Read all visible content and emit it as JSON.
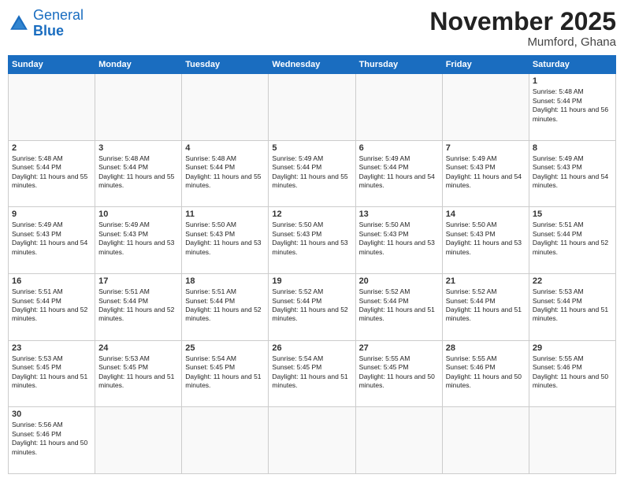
{
  "header": {
    "logo_general": "General",
    "logo_blue": "Blue",
    "month_title": "November 2025",
    "location": "Mumford, Ghana"
  },
  "weekdays": [
    "Sunday",
    "Monday",
    "Tuesday",
    "Wednesday",
    "Thursday",
    "Friday",
    "Saturday"
  ],
  "weeks": [
    [
      {
        "day": "",
        "sunrise": "",
        "sunset": "",
        "daylight": ""
      },
      {
        "day": "",
        "sunrise": "",
        "sunset": "",
        "daylight": ""
      },
      {
        "day": "",
        "sunrise": "",
        "sunset": "",
        "daylight": ""
      },
      {
        "day": "",
        "sunrise": "",
        "sunset": "",
        "daylight": ""
      },
      {
        "day": "",
        "sunrise": "",
        "sunset": "",
        "daylight": ""
      },
      {
        "day": "",
        "sunrise": "",
        "sunset": "",
        "daylight": ""
      },
      {
        "day": "1",
        "sunrise": "Sunrise: 5:48 AM",
        "sunset": "Sunset: 5:44 PM",
        "daylight": "Daylight: 11 hours and 56 minutes."
      }
    ],
    [
      {
        "day": "2",
        "sunrise": "Sunrise: 5:48 AM",
        "sunset": "Sunset: 5:44 PM",
        "daylight": "Daylight: 11 hours and 55 minutes."
      },
      {
        "day": "3",
        "sunrise": "Sunrise: 5:48 AM",
        "sunset": "Sunset: 5:44 PM",
        "daylight": "Daylight: 11 hours and 55 minutes."
      },
      {
        "day": "4",
        "sunrise": "Sunrise: 5:48 AM",
        "sunset": "Sunset: 5:44 PM",
        "daylight": "Daylight: 11 hours and 55 minutes."
      },
      {
        "day": "5",
        "sunrise": "Sunrise: 5:49 AM",
        "sunset": "Sunset: 5:44 PM",
        "daylight": "Daylight: 11 hours and 55 minutes."
      },
      {
        "day": "6",
        "sunrise": "Sunrise: 5:49 AM",
        "sunset": "Sunset: 5:44 PM",
        "daylight": "Daylight: 11 hours and 54 minutes."
      },
      {
        "day": "7",
        "sunrise": "Sunrise: 5:49 AM",
        "sunset": "Sunset: 5:43 PM",
        "daylight": "Daylight: 11 hours and 54 minutes."
      },
      {
        "day": "8",
        "sunrise": "Sunrise: 5:49 AM",
        "sunset": "Sunset: 5:43 PM",
        "daylight": "Daylight: 11 hours and 54 minutes."
      }
    ],
    [
      {
        "day": "9",
        "sunrise": "Sunrise: 5:49 AM",
        "sunset": "Sunset: 5:43 PM",
        "daylight": "Daylight: 11 hours and 54 minutes."
      },
      {
        "day": "10",
        "sunrise": "Sunrise: 5:49 AM",
        "sunset": "Sunset: 5:43 PM",
        "daylight": "Daylight: 11 hours and 53 minutes."
      },
      {
        "day": "11",
        "sunrise": "Sunrise: 5:50 AM",
        "sunset": "Sunset: 5:43 PM",
        "daylight": "Daylight: 11 hours and 53 minutes."
      },
      {
        "day": "12",
        "sunrise": "Sunrise: 5:50 AM",
        "sunset": "Sunset: 5:43 PM",
        "daylight": "Daylight: 11 hours and 53 minutes."
      },
      {
        "day": "13",
        "sunrise": "Sunrise: 5:50 AM",
        "sunset": "Sunset: 5:43 PM",
        "daylight": "Daylight: 11 hours and 53 minutes."
      },
      {
        "day": "14",
        "sunrise": "Sunrise: 5:50 AM",
        "sunset": "Sunset: 5:43 PM",
        "daylight": "Daylight: 11 hours and 53 minutes."
      },
      {
        "day": "15",
        "sunrise": "Sunrise: 5:51 AM",
        "sunset": "Sunset: 5:44 PM",
        "daylight": "Daylight: 11 hours and 52 minutes."
      }
    ],
    [
      {
        "day": "16",
        "sunrise": "Sunrise: 5:51 AM",
        "sunset": "Sunset: 5:44 PM",
        "daylight": "Daylight: 11 hours and 52 minutes."
      },
      {
        "day": "17",
        "sunrise": "Sunrise: 5:51 AM",
        "sunset": "Sunset: 5:44 PM",
        "daylight": "Daylight: 11 hours and 52 minutes."
      },
      {
        "day": "18",
        "sunrise": "Sunrise: 5:51 AM",
        "sunset": "Sunset: 5:44 PM",
        "daylight": "Daylight: 11 hours and 52 minutes."
      },
      {
        "day": "19",
        "sunrise": "Sunrise: 5:52 AM",
        "sunset": "Sunset: 5:44 PM",
        "daylight": "Daylight: 11 hours and 52 minutes."
      },
      {
        "day": "20",
        "sunrise": "Sunrise: 5:52 AM",
        "sunset": "Sunset: 5:44 PM",
        "daylight": "Daylight: 11 hours and 51 minutes."
      },
      {
        "day": "21",
        "sunrise": "Sunrise: 5:52 AM",
        "sunset": "Sunset: 5:44 PM",
        "daylight": "Daylight: 11 hours and 51 minutes."
      },
      {
        "day": "22",
        "sunrise": "Sunrise: 5:53 AM",
        "sunset": "Sunset: 5:44 PM",
        "daylight": "Daylight: 11 hours and 51 minutes."
      }
    ],
    [
      {
        "day": "23",
        "sunrise": "Sunrise: 5:53 AM",
        "sunset": "Sunset: 5:45 PM",
        "daylight": "Daylight: 11 hours and 51 minutes."
      },
      {
        "day": "24",
        "sunrise": "Sunrise: 5:53 AM",
        "sunset": "Sunset: 5:45 PM",
        "daylight": "Daylight: 11 hours and 51 minutes."
      },
      {
        "day": "25",
        "sunrise": "Sunrise: 5:54 AM",
        "sunset": "Sunset: 5:45 PM",
        "daylight": "Daylight: 11 hours and 51 minutes."
      },
      {
        "day": "26",
        "sunrise": "Sunrise: 5:54 AM",
        "sunset": "Sunset: 5:45 PM",
        "daylight": "Daylight: 11 hours and 51 minutes."
      },
      {
        "day": "27",
        "sunrise": "Sunrise: 5:55 AM",
        "sunset": "Sunset: 5:45 PM",
        "daylight": "Daylight: 11 hours and 50 minutes."
      },
      {
        "day": "28",
        "sunrise": "Sunrise: 5:55 AM",
        "sunset": "Sunset: 5:46 PM",
        "daylight": "Daylight: 11 hours and 50 minutes."
      },
      {
        "day": "29",
        "sunrise": "Sunrise: 5:55 AM",
        "sunset": "Sunset: 5:46 PM",
        "daylight": "Daylight: 11 hours and 50 minutes."
      }
    ],
    [
      {
        "day": "30",
        "sunrise": "Sunrise: 5:56 AM",
        "sunset": "Sunset: 5:46 PM",
        "daylight": "Daylight: 11 hours and 50 minutes."
      },
      {
        "day": "",
        "sunrise": "",
        "sunset": "",
        "daylight": ""
      },
      {
        "day": "",
        "sunrise": "",
        "sunset": "",
        "daylight": ""
      },
      {
        "day": "",
        "sunrise": "",
        "sunset": "",
        "daylight": ""
      },
      {
        "day": "",
        "sunrise": "",
        "sunset": "",
        "daylight": ""
      },
      {
        "day": "",
        "sunrise": "",
        "sunset": "",
        "daylight": ""
      },
      {
        "day": "",
        "sunrise": "",
        "sunset": "",
        "daylight": ""
      }
    ]
  ]
}
